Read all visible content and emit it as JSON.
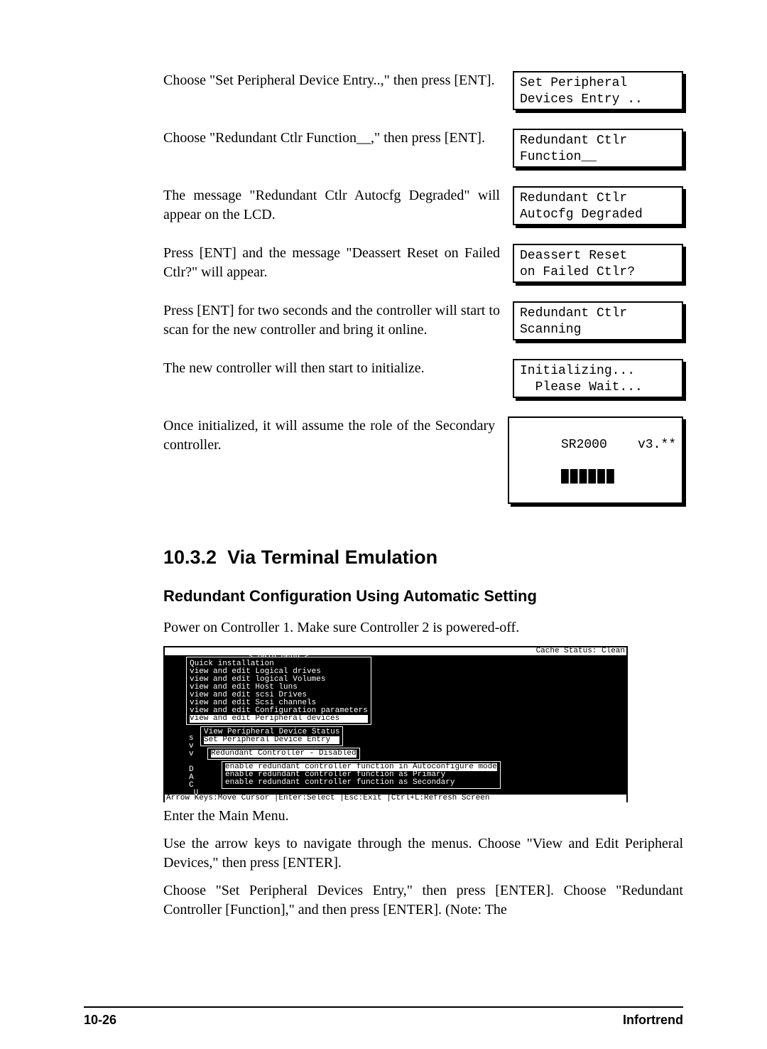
{
  "rows": [
    {
      "desc": "Choose \"Set Peripheral Device Entry..,\" then press [ENT].",
      "lcd": "Set Peripheral\nDevices Entry .."
    },
    {
      "desc": "Choose \"Redundant Ctlr Function__,\" then press [ENT].",
      "lcd": "Redundant Ctlr\nFunction__"
    },
    {
      "desc": "The message \"Redundant Ctlr Autocfg Degraded\" will appear on the LCD.",
      "lcd": "Redundant Ctlr\nAutocfg Degraded"
    },
    {
      "desc": "Press [ENT] and the message \"Deassert Reset on Failed Ctlr?\" will appear.",
      "lcd": "Deassert Reset\non Failed Ctlr?"
    },
    {
      "desc": "Press [ENT] for two seconds and the controller will start to scan for the new controller and bring it online.",
      "lcd": "Redundant Ctlr\nScanning"
    },
    {
      "desc": "The new controller will then start to initialize.",
      "lcd": "Initializing...\n  Please Wait..."
    },
    {
      "desc": "Once initialized, it will assume the role of the Secondary controller.",
      "lcd": "SR2000    v3.**",
      "blocks": true
    }
  ],
  "section_no": "10.3.2",
  "section_title": "Via Terminal Emulation",
  "subsection": "Redundant Configuration Using Automatic Setting",
  "poweron": "Power on Controller 1.  Make sure Controller 2 is powered-off.",
  "terminal": {
    "cache": "Cache Status: Clean",
    "title": "< Main Menu >",
    "m0": "Quick installation",
    "m1": "view and edit Logical drives",
    "m2": "view and edit logical Volumes",
    "m3": "view and edit Host luns",
    "m4": "view and edit scsi Drives",
    "m5": "view and edit Scsi channels",
    "m6": "view and edit Configuration parameters",
    "m7": "view and edit Peripheral devices",
    "letters": "s\nv\nv\n\nD\nA\nC\n U",
    "s0": "View Peripheral Device Status",
    "s1": "Set Peripheral Device Entry",
    "rc": "Redundant Controller - Disabled",
    "o0": "enable redundant controller function in Autoconfigure mode",
    "o1": "enable redundant controller function as Primary",
    "o2": "enable redundant controller function as Secondary",
    "status": "Arrow Keys:Move Cursor  |Enter:Select  |Esc:Exit  |Ctrl+L:Refresh Screen"
  },
  "after1": "Enter the Main Menu.",
  "after2": "Use the arrow keys to navigate through the menus.  Choose \"View and Edit Peripheral Devices,\" then press [ENTER].",
  "after3": "Choose \"Set Peripheral Devices Entry,\" then press [ENTER]. Choose \"Redundant Controller [Function],\" and then press [ENTER]. (Note: The",
  "footer_left": "10-26",
  "footer_right": "Infortrend"
}
